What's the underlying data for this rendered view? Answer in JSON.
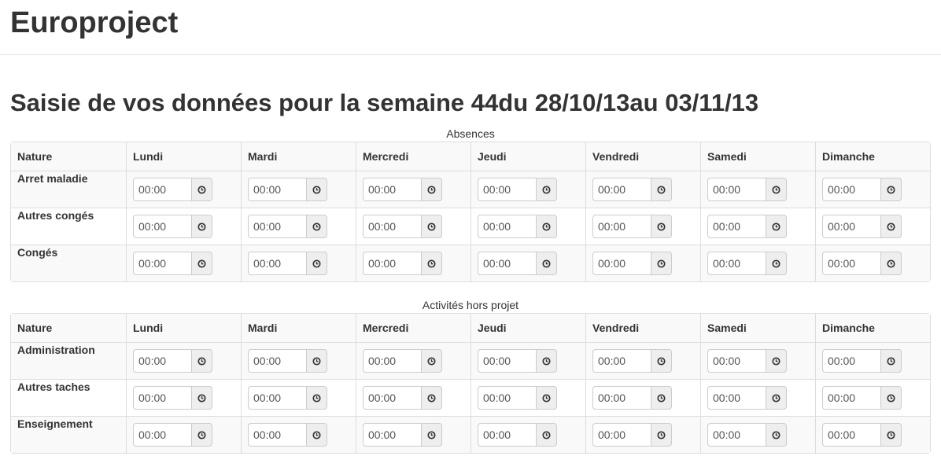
{
  "app": {
    "brand": "Europroject"
  },
  "page": {
    "title": "Saisie de vos données pour la semaine 44du 28/10/13au 03/11/13"
  },
  "tables": [
    {
      "caption": "Absences",
      "headers": [
        "Nature",
        "Lundi",
        "Mardi",
        "Mercredi",
        "Jeudi",
        "Vendredi",
        "Samedi",
        "Dimanche"
      ],
      "rows": [
        {
          "nature": "Arret maladie",
          "values": [
            "00:00",
            "00:00",
            "00:00",
            "00:00",
            "00:00",
            "00:00",
            "00:00"
          ]
        },
        {
          "nature": "Autres congés",
          "values": [
            "00:00",
            "00:00",
            "00:00",
            "00:00",
            "00:00",
            "00:00",
            "00:00"
          ]
        },
        {
          "nature": "Congés",
          "values": [
            "00:00",
            "00:00",
            "00:00",
            "00:00",
            "00:00",
            "00:00",
            "00:00"
          ]
        }
      ]
    },
    {
      "caption": "Activités hors projet",
      "headers": [
        "Nature",
        "Lundi",
        "Mardi",
        "Mercredi",
        "Jeudi",
        "Vendredi",
        "Samedi",
        "Dimanche"
      ],
      "rows": [
        {
          "nature": "Administration",
          "values": [
            "00:00",
            "00:00",
            "00:00",
            "00:00",
            "00:00",
            "00:00",
            "00:00"
          ]
        },
        {
          "nature": "Autres taches",
          "values": [
            "00:00",
            "00:00",
            "00:00",
            "00:00",
            "00:00",
            "00:00",
            "00:00"
          ]
        },
        {
          "nature": "Enseignement",
          "values": [
            "00:00",
            "00:00",
            "00:00",
            "00:00",
            "00:00",
            "00:00",
            "00:00"
          ]
        }
      ]
    }
  ],
  "icons": {
    "time_addon": "clock-icon"
  }
}
